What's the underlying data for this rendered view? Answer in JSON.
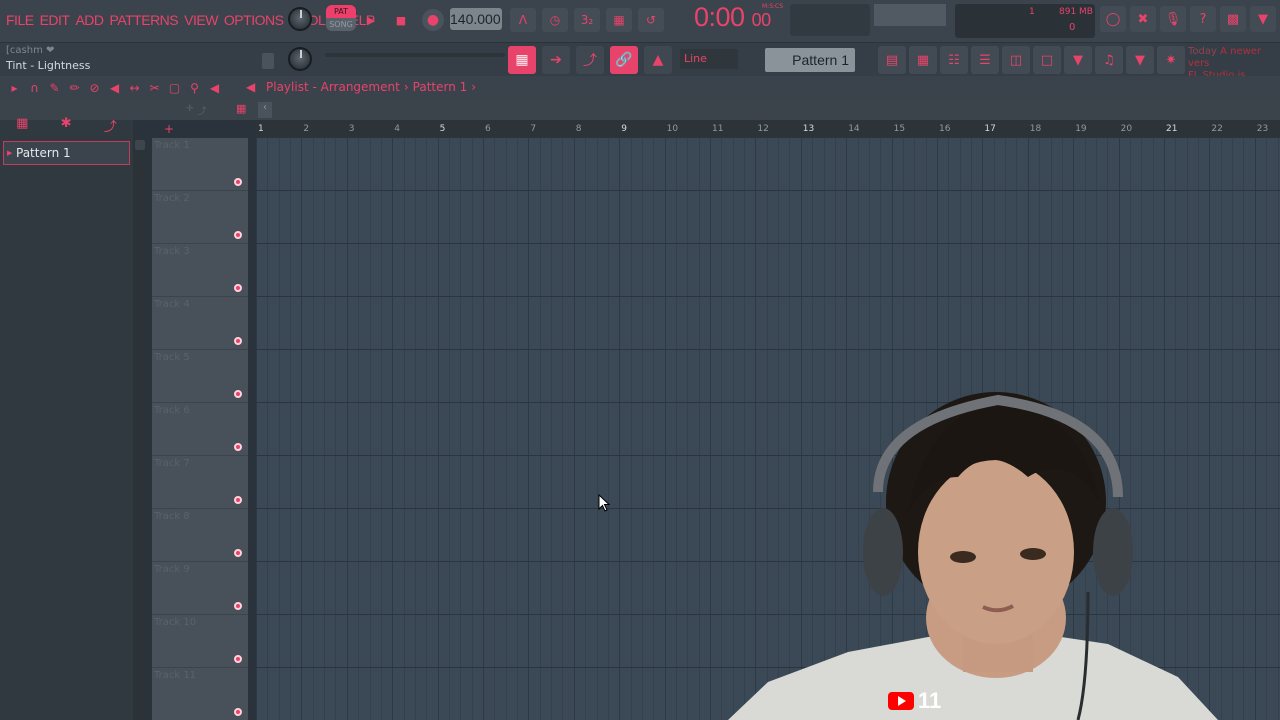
{
  "menu": [
    "FILE",
    "EDIT",
    "ADD",
    "PATTERNS",
    "VIEW",
    "OPTIONS",
    "TOOLS",
    "HELP"
  ],
  "transport": {
    "pat_label": "PAT",
    "song_label": "SONG",
    "tempo": "140.000",
    "time_display": "0:00",
    "time_frac": "00",
    "time_units": "M:S:CS",
    "cpu": "1",
    "memory": "891 MB",
    "polyphony": "0"
  },
  "hint_bar": {
    "top": "[cashm",
    "bottom": "Tint - Lightness"
  },
  "snap_mode": "Line",
  "pattern_selector": "Pattern 1",
  "news": {
    "day": "Today",
    "line1": "A newer vers",
    "line2": "FL Studio is available"
  },
  "playlist": {
    "crumb": [
      "Playlist - Arrangement",
      "›",
      "Pattern 1",
      "›"
    ],
    "pattern_item": "Pattern 1",
    "tracks": [
      "Track 1",
      "Track 2",
      "Track 3",
      "Track 4",
      "Track 5",
      "Track 6",
      "Track 7",
      "Track 8",
      "Track 9",
      "Track 10",
      "Track 11"
    ],
    "bars": [
      "1",
      "2",
      "3",
      "4",
      "5",
      "6",
      "7",
      "8",
      "9",
      "10",
      "11",
      "12",
      "13",
      "14",
      "15",
      "16",
      "17",
      "18",
      "19",
      "20",
      "21",
      "22",
      "23"
    ]
  },
  "overlay": {
    "youtube_count": "11"
  },
  "colors": {
    "accent": "#e8436a",
    "grid_bg": "#3b4855",
    "toolbar_bg": "#3b444c"
  }
}
